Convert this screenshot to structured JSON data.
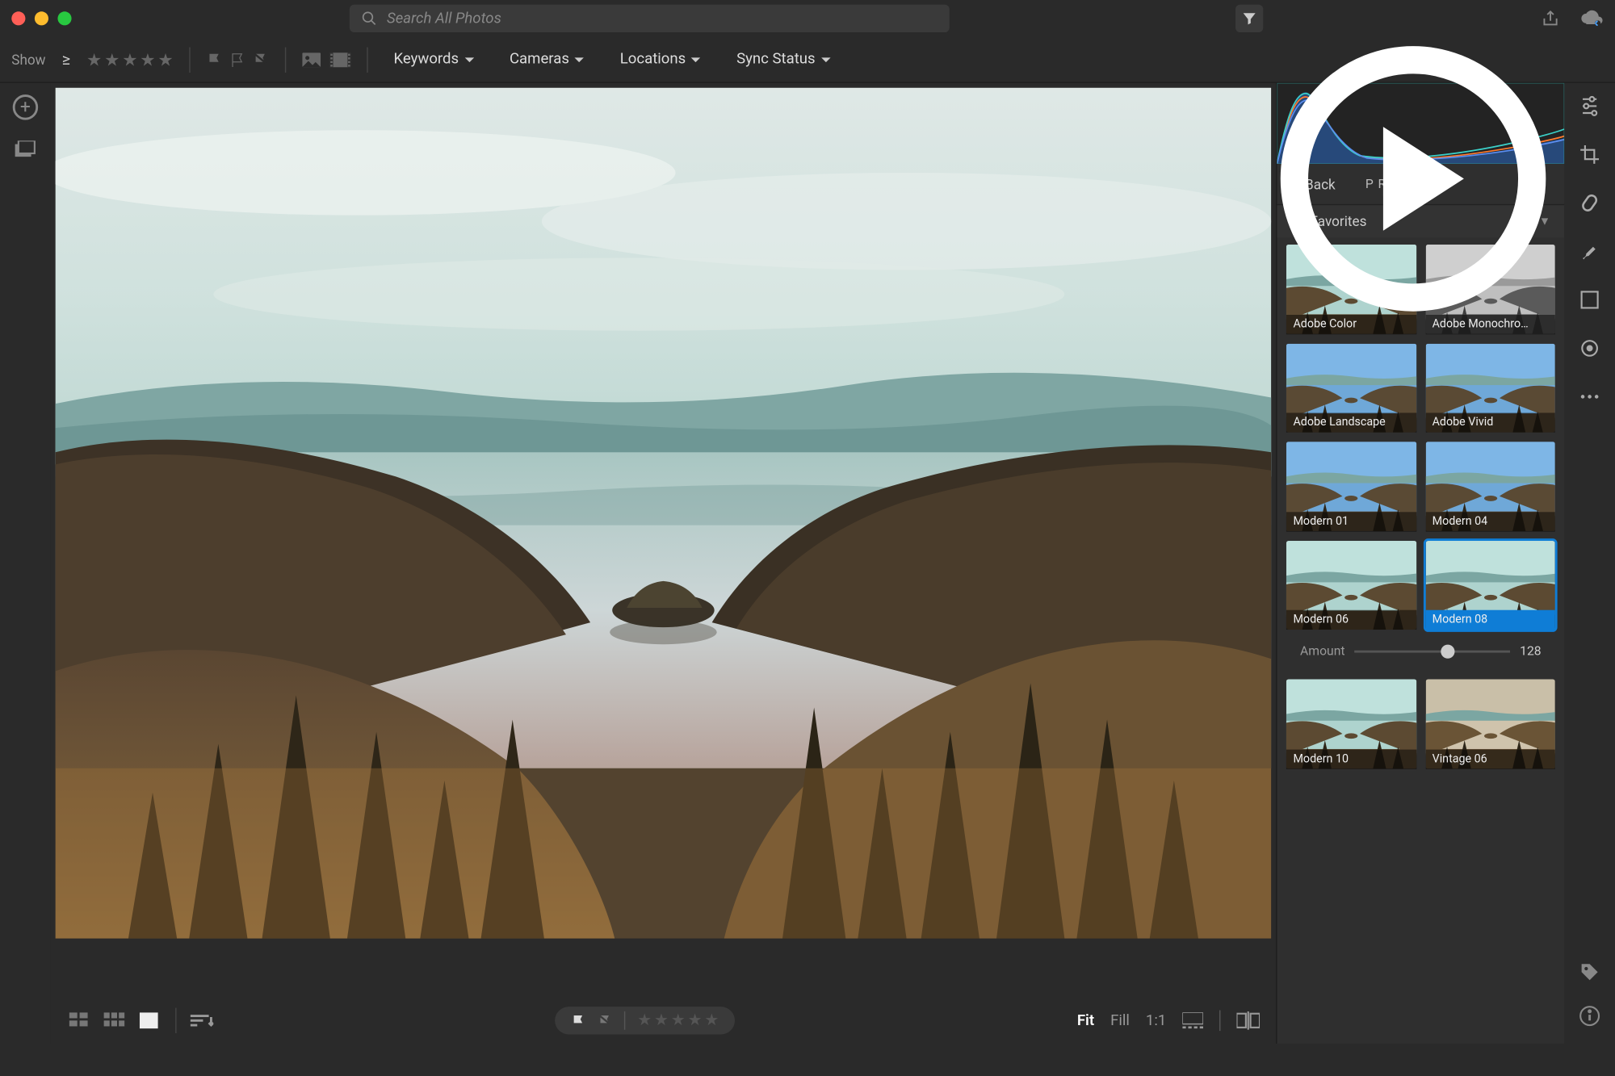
{
  "search": {
    "placeholder": "Search All Photos"
  },
  "filterbar": {
    "show_label": "Show",
    "rating_op": "≥",
    "dropdowns": [
      "Keywords",
      "Cameras",
      "Locations",
      "Sync Status"
    ]
  },
  "panel": {
    "back_label": "Back",
    "title": "PROFILE",
    "favorites_label": "Favorites"
  },
  "profiles": [
    [
      {
        "label": "Adobe Color",
        "variant": "teal"
      },
      {
        "label": "Adobe Monochro…",
        "variant": "mono"
      }
    ],
    [
      {
        "label": "Adobe Landscape",
        "variant": "blue"
      },
      {
        "label": "Adobe Vivid",
        "variant": "blue"
      }
    ],
    [
      {
        "label": "Modern 01",
        "variant": "blue"
      },
      {
        "label": "Modern 04",
        "variant": "blue"
      }
    ],
    [
      {
        "label": "Modern 06",
        "variant": "teal"
      },
      {
        "label": "Modern 08",
        "variant": "teal",
        "selected": true
      }
    ],
    [
      {
        "label": "Modern 10",
        "variant": "teal"
      },
      {
        "label": "Vintage 06",
        "variant": "warm"
      }
    ]
  ],
  "amount": {
    "label": "Amount",
    "value": "128"
  },
  "zoom": {
    "fit": "Fit",
    "fill": "Fill",
    "one": "1:1"
  }
}
